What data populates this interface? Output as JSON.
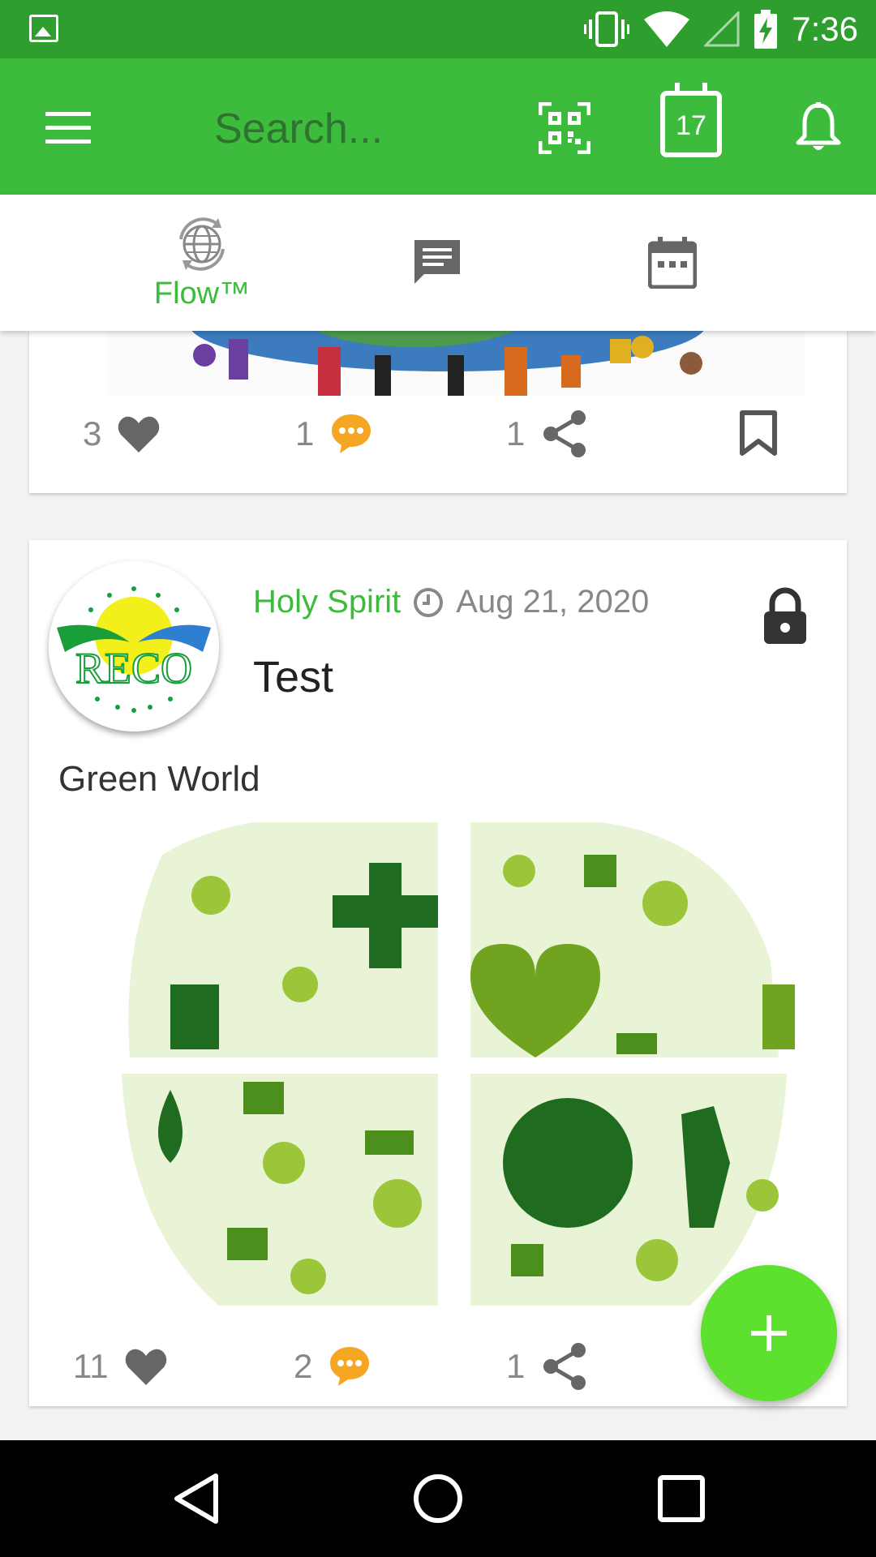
{
  "status_bar": {
    "time": "7:36",
    "icons": [
      "image-icon",
      "vibrate-icon",
      "wifi-icon",
      "signal-icon",
      "battery-charging-icon"
    ]
  },
  "app_bar": {
    "search_placeholder": "Search...",
    "calendar_day": "17",
    "icons": [
      "menu-icon",
      "qr-code-icon",
      "calendar-icon",
      "bell-icon"
    ],
    "colors": {
      "status": "#2e9e2e",
      "bar": "#3cbb3c"
    }
  },
  "tabs": [
    {
      "label": "Flow™",
      "icon": "globe-sync-icon",
      "active": true
    },
    {
      "label": "",
      "icon": "chat-icon"
    },
    {
      "label": "",
      "icon": "calendar-icon"
    }
  ],
  "posts": [
    {
      "likes": "3",
      "comments": "1",
      "shares": "1"
    },
    {
      "author": "Holy Spirit",
      "date": "Aug 21, 2020",
      "title": "Test",
      "body": "Green World",
      "avatar_text": "RECO",
      "likes": "11",
      "comments": "2",
      "shares": "1"
    }
  ],
  "accent_colors": {
    "comment": "#f5a623",
    "fab": "#5ee02e",
    "icon_gray": "#666666"
  }
}
